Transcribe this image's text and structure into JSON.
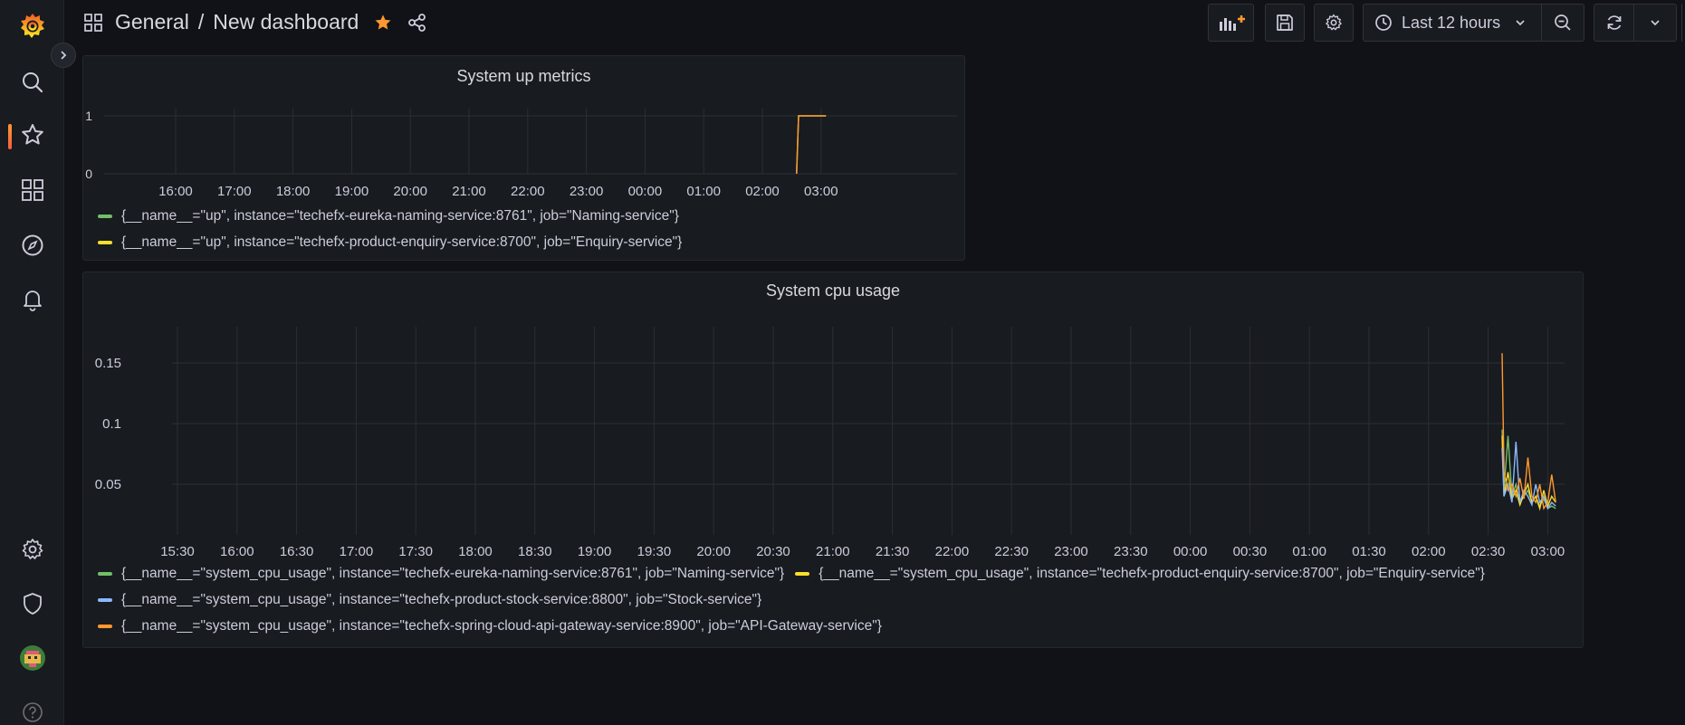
{
  "breadcrumb": {
    "folder": "General",
    "separator": "/",
    "dashboard": "New dashboard"
  },
  "time_range": {
    "label": "Last 12 hours"
  },
  "colors": {
    "accent": "#ff9830",
    "green": "#73bf69",
    "yellow": "#fade2a",
    "blue": "#8ab8ff",
    "orange": "#ff9830",
    "grid": "#2c2f35"
  },
  "panels": [
    {
      "title": "System up metrics",
      "y_ticks": [
        "1",
        "0"
      ],
      "x_ticks": [
        "16:00",
        "17:00",
        "18:00",
        "19:00",
        "20:00",
        "21:00",
        "22:00",
        "23:00",
        "00:00",
        "01:00",
        "02:00",
        "03:00"
      ],
      "legend": [
        {
          "label": "{__name__=\"up\", instance=\"techefx-eureka-naming-service:8761\", job=\"Naming-service\"}",
          "color": "#73bf69"
        },
        {
          "label": "{__name__=\"up\", instance=\"techefx-product-enquiry-service:8700\", job=\"Enquiry-service\"}",
          "color": "#fade2a"
        }
      ]
    },
    {
      "title": "System cpu usage",
      "y_ticks": [
        "0.15",
        "0.1",
        "0.05"
      ],
      "x_ticks": [
        "15:30",
        "16:00",
        "16:30",
        "17:00",
        "17:30",
        "18:00",
        "18:30",
        "19:00",
        "19:30",
        "20:00",
        "20:30",
        "21:00",
        "21:30",
        "22:00",
        "22:30",
        "23:00",
        "23:30",
        "00:00",
        "00:30",
        "01:00",
        "01:30",
        "02:00",
        "02:30",
        "03:00"
      ],
      "legend": [
        {
          "label": "{__name__=\"system_cpu_usage\", instance=\"techefx-eureka-naming-service:8761\", job=\"Naming-service\"}",
          "color": "#73bf69"
        },
        {
          "label": "{__name__=\"system_cpu_usage\", instance=\"techefx-product-enquiry-service:8700\", job=\"Enquiry-service\"}",
          "color": "#fade2a"
        },
        {
          "label": "{__name__=\"system_cpu_usage\", instance=\"techefx-product-stock-service:8800\", job=\"Stock-service\"}",
          "color": "#8ab8ff"
        },
        {
          "label": "{__name__=\"system_cpu_usage\", instance=\"techefx-spring-cloud-api-gateway-service:8900\", job=\"API-Gateway-service\"}",
          "color": "#ff9830"
        }
      ]
    }
  ],
  "chart_data": [
    {
      "type": "line",
      "title": "System up metrics",
      "x": [
        "02:35",
        "02:37",
        "03:05"
      ],
      "ylim": [
        0,
        1
      ],
      "series": [
        {
          "name": "{__name__=\"up\", instance=\"techefx-eureka-naming-service:8761\", job=\"Naming-service\"}",
          "values": [
            0,
            1,
            1
          ]
        },
        {
          "name": "{__name__=\"up\", instance=\"techefx-product-enquiry-service:8700\", job=\"Enquiry-service\"}",
          "values": [
            0,
            1,
            1
          ]
        }
      ]
    },
    {
      "type": "line",
      "title": "System cpu usage",
      "x": [
        "02:37",
        "02:38",
        "02:40",
        "02:42",
        "02:44",
        "02:46",
        "02:48",
        "02:50",
        "02:52",
        "02:54",
        "02:56",
        "02:58",
        "03:00",
        "03:02",
        "03:04"
      ],
      "ylim": [
        0.02,
        0.19
      ],
      "series": [
        {
          "name": "{__name__=\"system_cpu_usage\", instance=\"techefx-eureka-naming-service:8761\", job=\"Naming-service\"}",
          "values": [
            0.095,
            0.045,
            0.09,
            0.04,
            0.05,
            0.035,
            0.04,
            0.045,
            0.035,
            0.04,
            0.032,
            0.038,
            0.03,
            0.032,
            0.03
          ]
        },
        {
          "name": "{__name__=\"system_cpu_usage\", instance=\"techefx-product-enquiry-service:8700\", job=\"Enquiry-service\"}",
          "values": [
            0.09,
            0.04,
            0.06,
            0.038,
            0.045,
            0.033,
            0.042,
            0.05,
            0.035,
            0.04,
            0.03,
            0.045,
            0.032,
            0.04,
            0.035
          ]
        },
        {
          "name": "{__name__=\"system_cpu_usage\", instance=\"techefx-product-stock-service:8800\", job=\"Stock-service\"}",
          "values": [
            0.08,
            0.04,
            0.05,
            0.035,
            0.085,
            0.035,
            0.045,
            0.04,
            0.033,
            0.05,
            0.035,
            0.04,
            0.03,
            0.035,
            0.032
          ]
        },
        {
          "name": "{__name__=\"system_cpu_usage\", instance=\"techefx-spring-cloud-api-gateway-service:8900\", job=\"API-Gateway-service\"}",
          "values": [
            0.158,
            0.06,
            0.045,
            0.05,
            0.04,
            0.055,
            0.038,
            0.072,
            0.04,
            0.035,
            0.05,
            0.03,
            0.035,
            0.058,
            0.035
          ]
        }
      ]
    }
  ]
}
